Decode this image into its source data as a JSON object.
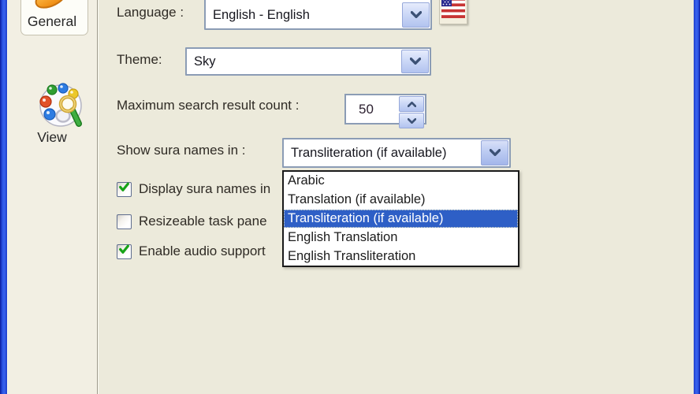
{
  "dialog": {
    "name": "Options dialog — General page",
    "sidebar": {
      "items": [
        {
          "label": "General",
          "selected": true
        },
        {
          "label": "View",
          "selected": false
        }
      ]
    },
    "language": {
      "label": "Language :",
      "value": "English - English",
      "flag": "us-flag-icon"
    },
    "theme": {
      "label": "Theme:",
      "value": "Sky"
    },
    "max_search": {
      "label": "Maximum search result count :",
      "value": "50"
    },
    "sura_names": {
      "label": "Show sura names in :",
      "value": "Transliteration (if available)",
      "options": [
        "Arabic",
        "Translation (if available)",
        "Transliteration (if available)",
        "English Translation",
        "English Transliteration"
      ],
      "selected_option_index": 2
    },
    "checkboxes": [
      {
        "label": "Display sura names in",
        "checked": true
      },
      {
        "label": "Resizeable task pane",
        "checked": false
      },
      {
        "label": "Enable audio support",
        "checked": true
      }
    ],
    "colors": {
      "selection_blue": "#316ac5",
      "checkbox_check_green": "#17a317",
      "window_border_blue": "#2c55e4",
      "dialog_background": "#eceadb",
      "combo_border": "#8b9cb5"
    }
  }
}
